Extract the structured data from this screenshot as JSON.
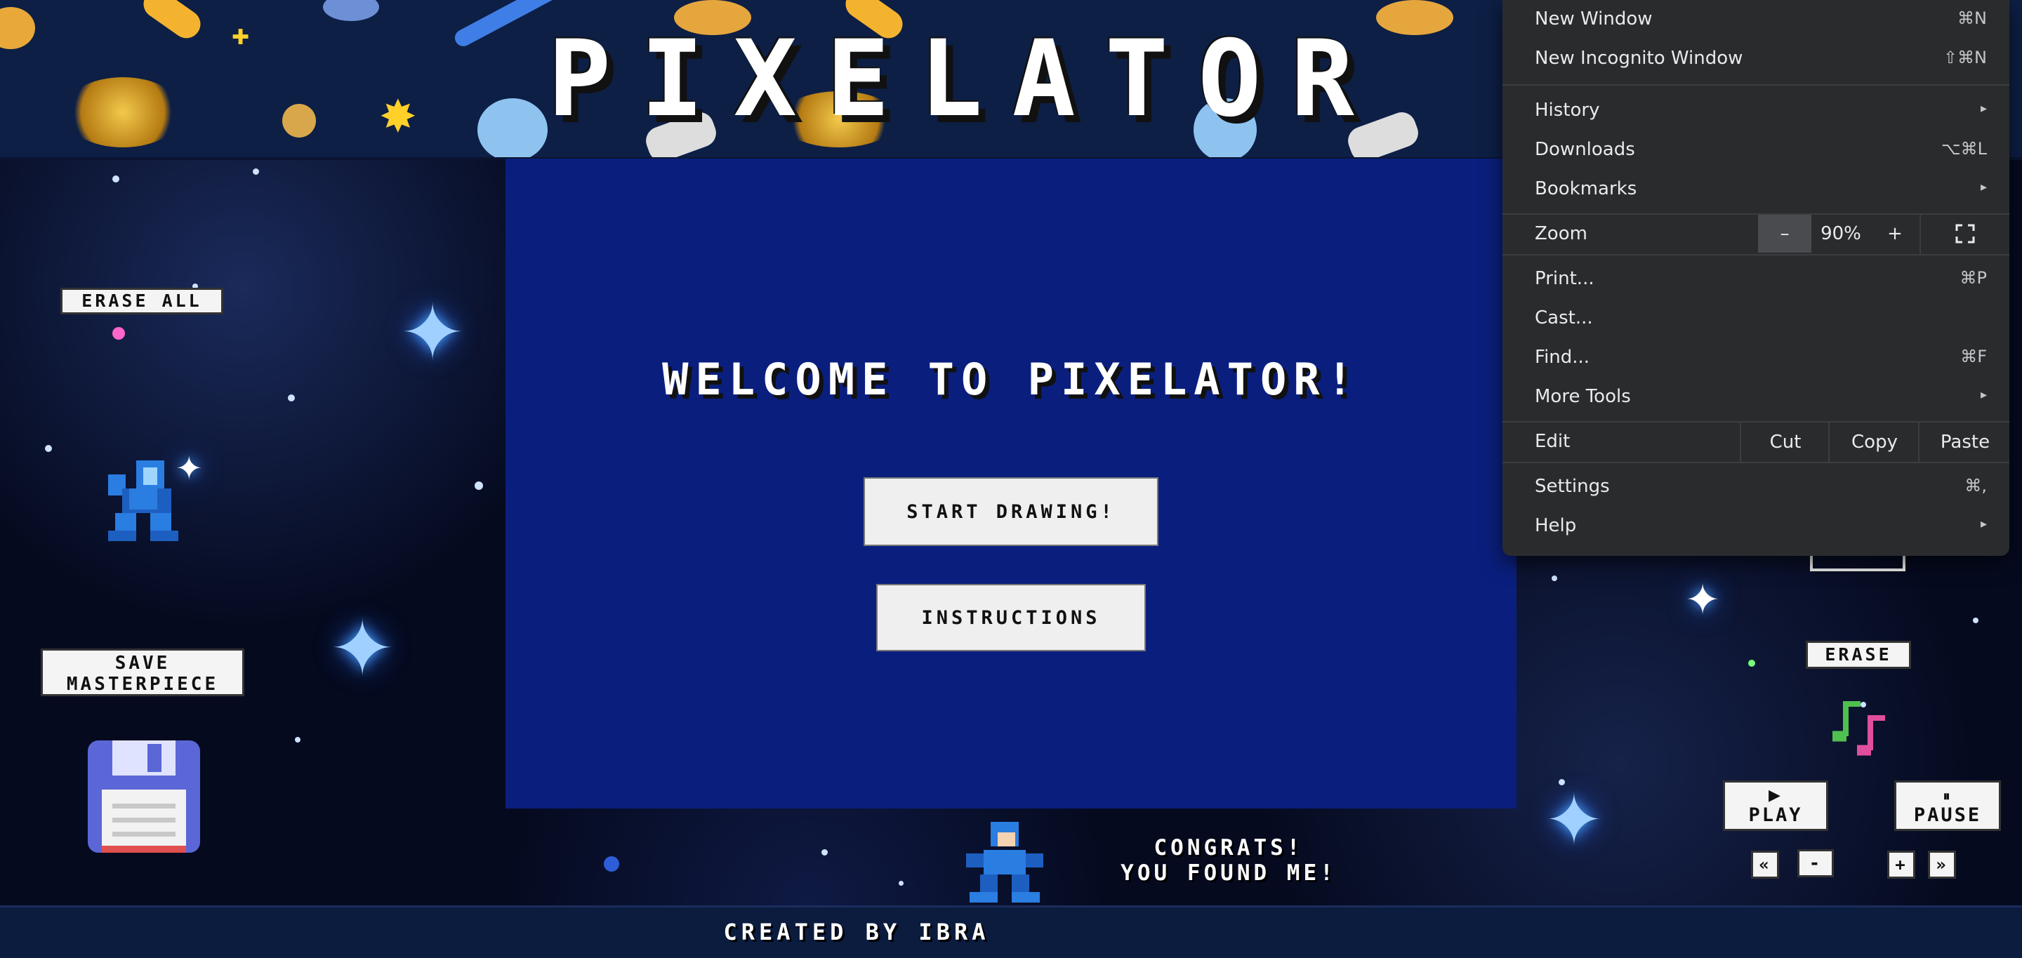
{
  "header": {
    "title": "PIXELATOR"
  },
  "panel": {
    "welcome": "WELCOME TO PIXELATOR!",
    "start_button": "START DRAWING!",
    "instructions_button": "INSTRUCTIONS"
  },
  "left": {
    "erase_all": "ERASE ALL",
    "save_line1": "SAVE",
    "save_line2": "MASTERPIECE"
  },
  "right": {
    "erase": "ERASE",
    "play_icon": "▶",
    "play": "PLAY",
    "pause_icon": "⏸",
    "pause": "PAUSE",
    "rewind": "«",
    "minus": "-",
    "plus": "+",
    "forward": "»"
  },
  "congrats": {
    "line1": "CONGRATS!",
    "line2": "YOU FOUND ME!"
  },
  "footer": {
    "credit": "CREATED BY IBRA"
  },
  "menu": {
    "new_window": "New Window",
    "new_window_sc": "⌘N",
    "new_incognito": "New Incognito Window",
    "new_incognito_sc": "⇧⌘N",
    "history": "History",
    "downloads": "Downloads",
    "downloads_sc": "⌥⌘L",
    "bookmarks": "Bookmarks",
    "zoom": "Zoom",
    "zoom_minus": "–",
    "zoom_level": "90%",
    "zoom_plus": "+",
    "print": "Print...",
    "print_sc": "⌘P",
    "cast": "Cast...",
    "find": "Find...",
    "find_sc": "⌘F",
    "more_tools": "More Tools",
    "edit": "Edit",
    "cut": "Cut",
    "copy": "Copy",
    "paste": "Paste",
    "settings": "Settings",
    "settings_sc": "⌘,",
    "help": "Help",
    "arrow": "▸"
  },
  "colors": {
    "panel": "#0a1f7d",
    "header": "#0d1f45",
    "menu_bg": "#2a2b2d",
    "zoom_minus_bg": "#4a4b4e",
    "megaman_blue": "#2a7de1",
    "floppy": "#5b67d6"
  }
}
